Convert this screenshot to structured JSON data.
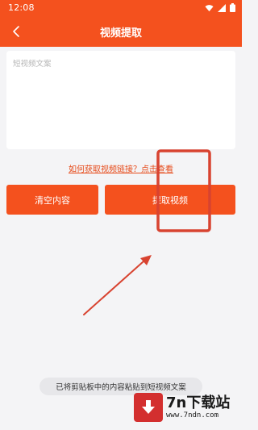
{
  "status_bar": {
    "time": "12:08",
    "icons": [
      "wifi-icon",
      "signal-icon",
      "battery-icon"
    ]
  },
  "header": {
    "title": "视频提取",
    "back_icon": "chevron-left-icon"
  },
  "input": {
    "placeholder": "短视频文案",
    "value": ""
  },
  "help_link": "如何获取视频链接？点击查看",
  "buttons": {
    "clear_label": "清空内容",
    "extract_label": "提取视频"
  },
  "toast": "已将剪贴板中的内容粘贴到短视频文案",
  "watermark": {
    "brand": "7n下载站",
    "url": "www.7ndn.com"
  },
  "colors": {
    "accent": "#f4511e",
    "background": "#f4f4f6",
    "annotation": "#d84330"
  }
}
